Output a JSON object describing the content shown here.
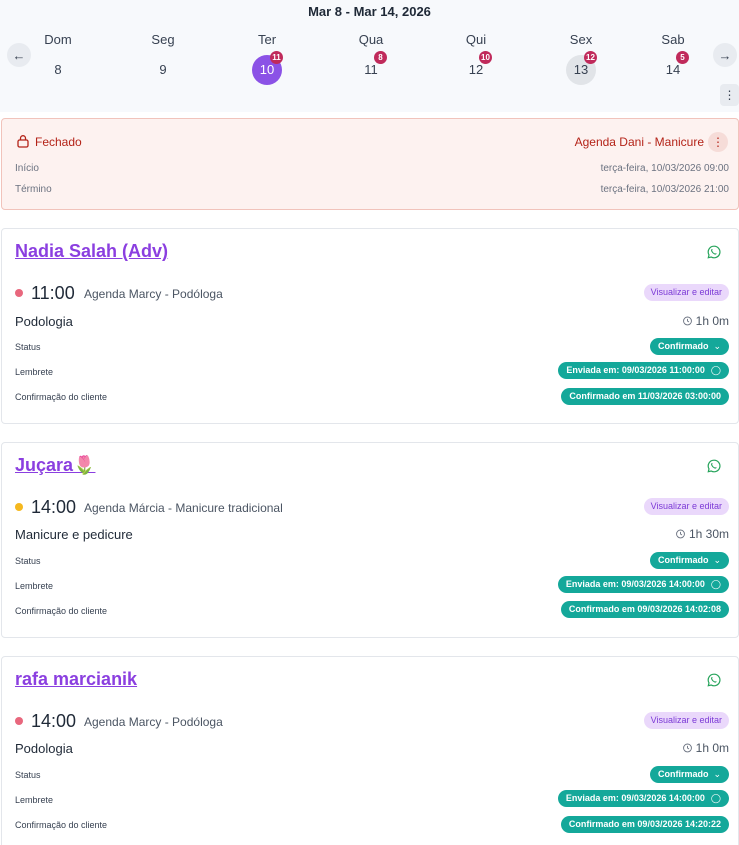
{
  "header": {
    "week_title": "Mar 8 - Mar 14, 2026",
    "prev_icon": "arrow-left-icon",
    "next_icon": "arrow-right-icon",
    "more_icon": "kebab-icon",
    "days": [
      {
        "name": "Dom",
        "num": "8",
        "count": ""
      },
      {
        "name": "Seg",
        "num": "9",
        "count": ""
      },
      {
        "name": "Ter",
        "num": "10",
        "count": "11"
      },
      {
        "name": "Qua",
        "num": "11",
        "count": "8"
      },
      {
        "name": "Qui",
        "num": "12",
        "count": "10"
      },
      {
        "name": "Sex",
        "num": "13",
        "count": "12"
      },
      {
        "name": "Sab",
        "num": "14",
        "count": "5"
      }
    ]
  },
  "closed_block": {
    "status": "Fechado",
    "agenda": "Agenda Dani - Manicure",
    "start_label": "Início",
    "start_value": "terça-feira, 10/03/2026 09:00",
    "end_label": "Término",
    "end_value": "terça-feira, 10/03/2026 21:00",
    "color": "#b42318"
  },
  "labels": {
    "view_edit": "Visualizar e editar",
    "status": "Status",
    "reminder": "Lembrete",
    "client_confirmation": "Confirmação do cliente"
  },
  "appointments": [
    {
      "client": "Nadia Salah (Adv)",
      "time": "11:00",
      "agenda": "Agenda Marcy - Podóloga",
      "dot_color": "#e8677d",
      "service": "Podologia",
      "duration": "1h 0m",
      "status": "Confirmado",
      "reminder": "Enviada em: 09/03/2026 11:00:00",
      "confirmation": "Confirmado em 11/03/2026 03:00:00"
    },
    {
      "client": "Juçara🌷",
      "time": "14:00",
      "agenda": "Agenda Márcia - Manicure tradicional",
      "dot_color": "#f5b81f",
      "service": "Manicure e pedicure",
      "duration": "1h 30m",
      "status": "Confirmado",
      "reminder": "Enviada em: 09/03/2026 14:00:00",
      "confirmation": "Confirmado em 09/03/2026 14:02:08"
    },
    {
      "client": "rafa marcianik",
      "time": "14:00",
      "agenda": "Agenda Marcy - Podóloga",
      "dot_color": "#e8677d",
      "service": "Podologia",
      "duration": "1h 0m",
      "status": "Confirmado",
      "reminder": "Enviada em: 09/03/2026 14:00:00",
      "confirmation": "Confirmado em 09/03/2026 14:20:22"
    }
  ],
  "colors": {
    "accent": "#8b52e6",
    "badge": "#c02a5b",
    "teal": "#14a89a",
    "whatsapp": "#25a35a"
  }
}
